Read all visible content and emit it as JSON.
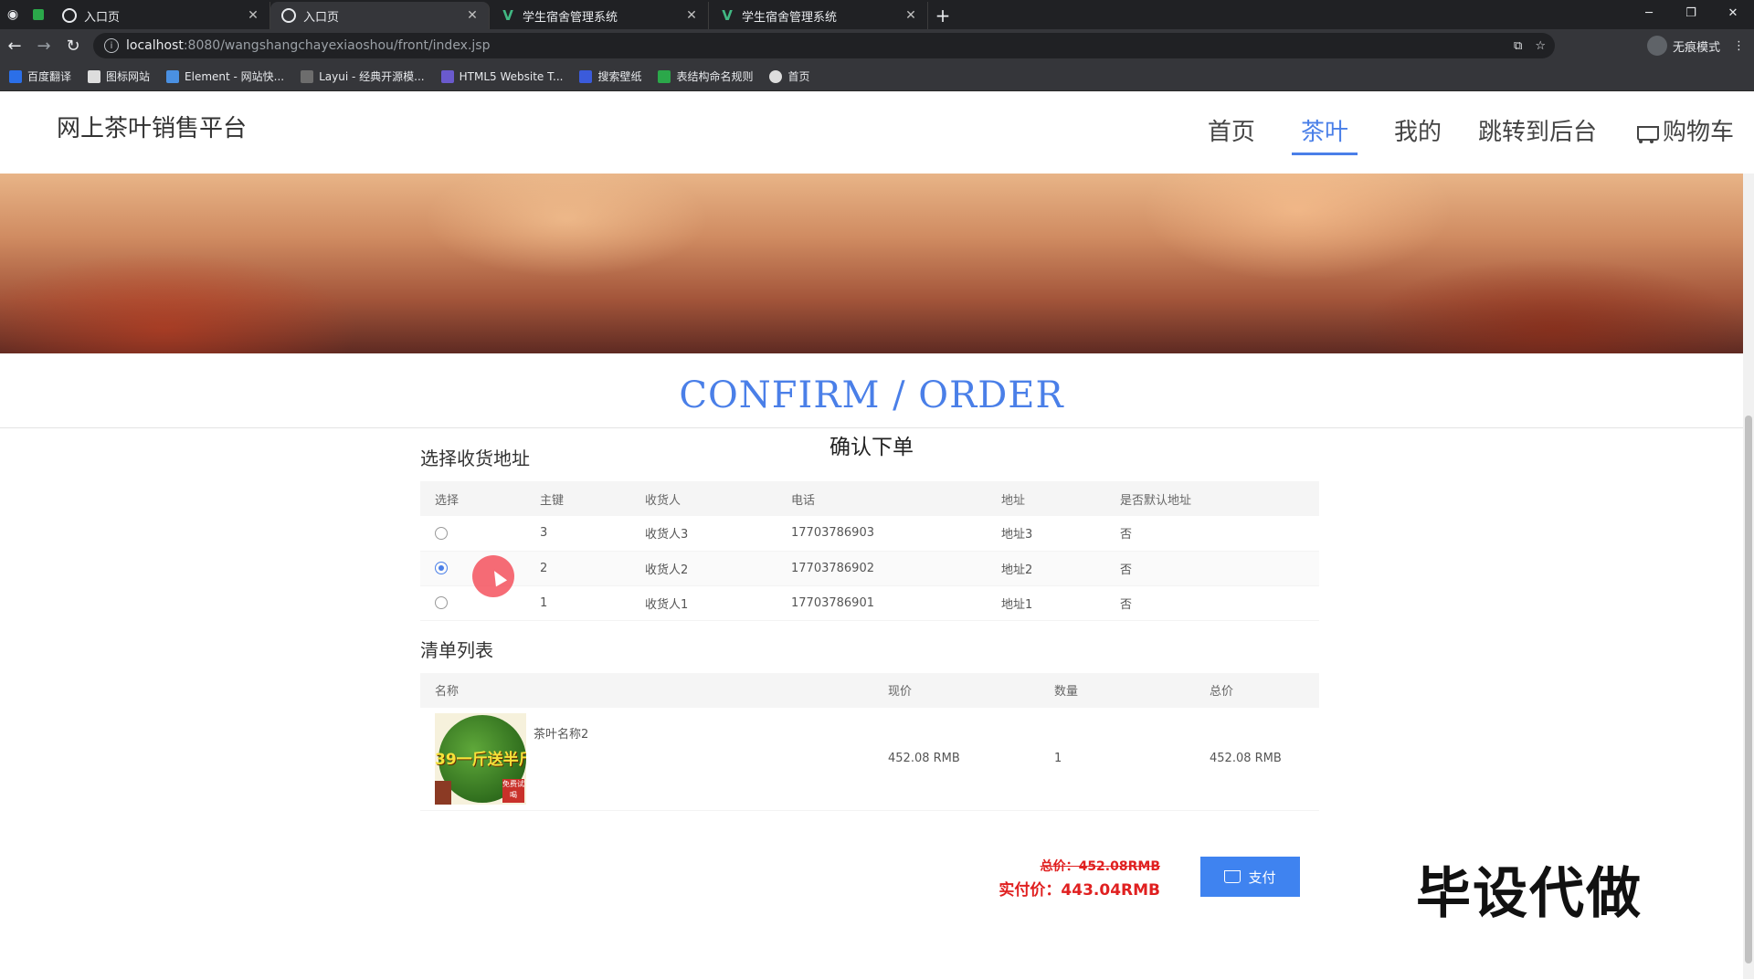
{
  "browser": {
    "tabs": [
      {
        "title": "入口页",
        "icon": "globe-icon",
        "active": false
      },
      {
        "title": "入口页",
        "icon": "globe-icon",
        "active": true
      },
      {
        "title": "学生宿舍管理系统",
        "icon": "vue-icon",
        "active": false
      },
      {
        "title": "学生宿舍管理系统",
        "icon": "vue-icon",
        "active": false
      }
    ],
    "url_host": "localhost",
    "url_path": ":8080/wangshangchayexiaoshou/front/index.jsp",
    "profile_label": "无痕模式",
    "bookmarks": [
      {
        "label": "百度翻译",
        "color": "#2b6fe8"
      },
      {
        "label": "图标网站",
        "color": "#222222"
      },
      {
        "label": "Element - 网站快...",
        "color": "#4a90e2"
      },
      {
        "label": "Layui - 经典开源模...",
        "color": "#6d6d6d"
      },
      {
        "label": "HTML5 Website T...",
        "color": "#6a5acd"
      },
      {
        "label": "搜索壁纸",
        "color": "#3b5bdb"
      },
      {
        "label": "表结构命名规则",
        "color": "#2ba84a"
      },
      {
        "label": "首页",
        "color": "#dddddd"
      }
    ]
  },
  "site": {
    "logo": "网上茶叶销售平台",
    "nav": [
      {
        "label": "首页",
        "active": false
      },
      {
        "label": "茶叶",
        "active": true
      },
      {
        "label": "我的",
        "active": false
      },
      {
        "label": "跳转到后台",
        "active": false
      },
      {
        "label": "购物车",
        "active": false
      }
    ]
  },
  "section": {
    "title_en": "CONFIRM / ORDER",
    "title_cn": "确认下单"
  },
  "address": {
    "heading": "选择收货地址",
    "columns": [
      "选择",
      "主键",
      "收货人",
      "电话",
      "地址",
      "是否默认地址"
    ],
    "rows": [
      {
        "selected": false,
        "id": "3",
        "name": "收货人3",
        "phone": "17703786903",
        "addr": "地址3",
        "default": "否"
      },
      {
        "selected": true,
        "id": "2",
        "name": "收货人2",
        "phone": "17703786902",
        "addr": "地址2",
        "default": "否"
      },
      {
        "selected": false,
        "id": "1",
        "name": "收货人1",
        "phone": "17703786901",
        "addr": "地址1",
        "default": "否"
      }
    ]
  },
  "cart": {
    "heading": "清单列表",
    "columns": [
      "名称",
      "现价",
      "数量",
      "总价"
    ],
    "items": [
      {
        "name": "茶叶名称2",
        "price": "452.08 RMB",
        "qty": "1",
        "total": "452.08 RMB",
        "image_promo": "39一斤送半斤",
        "image_tag": "免费试喝"
      }
    ]
  },
  "summary": {
    "old_total": "总价：452.08RMB",
    "real_total": "实付价：443.04RMB",
    "pay_label": "支付"
  },
  "watermark": "毕设代做"
}
